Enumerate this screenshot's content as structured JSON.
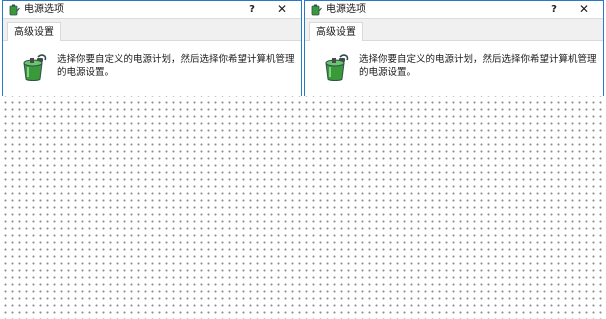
{
  "dialogs": [
    {
      "title": "电源选项",
      "help_label": "?",
      "close_label": "✕",
      "tab_label": "高级设置",
      "description_line1": "选择你要自定义的电源计划，然后选择你希望计算机管理",
      "description_line2": "的电源设置。"
    },
    {
      "title": "电源选项",
      "help_label": "?",
      "close_label": "✕",
      "tab_label": "高级设置",
      "description_line1": "选择你要自定义的电源计划，然后选择你希望计算机管理",
      "description_line2": "的电源设置。"
    }
  ],
  "icons": {
    "title_icon": "power-options-icon",
    "content_icon": "battery-plug-icon"
  },
  "colors": {
    "window_border": "#2b78c8",
    "tab_strip": "#f0f0f0",
    "icon_green": "#3a9a3a",
    "icon_dark": "#2f4f4f"
  }
}
